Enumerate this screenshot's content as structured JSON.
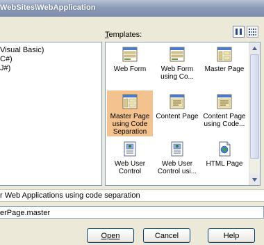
{
  "window": {
    "title": "WebSites\\WebApplication"
  },
  "templates": {
    "label_prefix": "T",
    "label_rest": "emplates:"
  },
  "languages": [
    {
      "label": "Visual Basic)"
    },
    {
      "label": "C#)"
    },
    {
      "label": "J#)"
    }
  ],
  "template_items": [
    {
      "label": "Web Form",
      "icon": "web-form-icon",
      "selected": false
    },
    {
      "label": "Web Form using Co...",
      "icon": "web-form-icon",
      "selected": false
    },
    {
      "label": "Master Page",
      "icon": "master-page-icon",
      "selected": false
    },
    {
      "label": "Master Page using Code Separation",
      "icon": "master-page-icon",
      "selected": true
    },
    {
      "label": "Content Page",
      "icon": "content-page-icon",
      "selected": false
    },
    {
      "label": "Content Page using Code...",
      "icon": "content-page-icon",
      "selected": false
    },
    {
      "label": "Web User Control",
      "icon": "user-control-icon",
      "selected": false
    },
    {
      "label": "Web User Control usi...",
      "icon": "user-control-icon",
      "selected": false
    },
    {
      "label": "HTML Page",
      "icon": "html-page-icon",
      "selected": false
    }
  ],
  "description": {
    "text": "r Web Applications using code separation"
  },
  "name_field": {
    "value": "erPage.master"
  },
  "buttons": {
    "open": "Open",
    "cancel": "Cancel",
    "help": "Help"
  },
  "colors": {
    "selection": "#f4c28f",
    "title_bar": "#8c9bb8",
    "dialog_bg": "#ece9d8"
  }
}
